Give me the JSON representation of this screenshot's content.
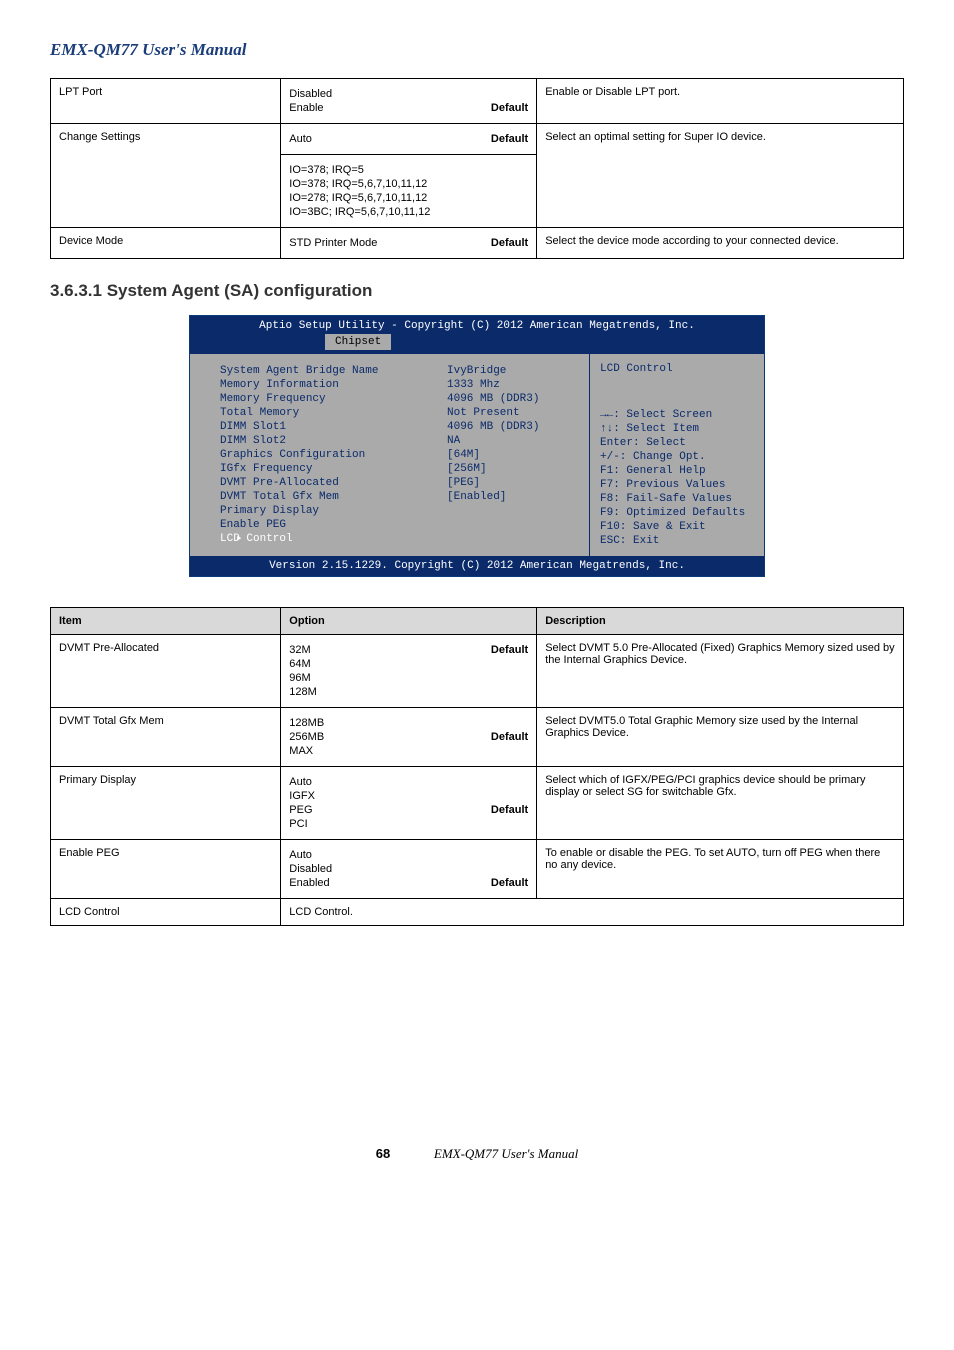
{
  "title1": "EMX-QM77 User's Manual",
  "table1": {
    "rows": [
      {
        "item": "LPT Port",
        "opts": [
          "Disabled",
          "Enable"
        ],
        "opts_note": "Default",
        "desc": "Enable or Disable LPT port."
      },
      {
        "item": "Change Settings",
        "opts": [
          "Auto"
        ],
        "opts_note": "Default",
        "row_span_first": true
      },
      {
        "item": "",
        "opts": [
          "IO=378; IRQ=5",
          "IO=378; IRQ=5,6,7,10,11,12",
          "IO=278; IRQ=5,6,7,10,11,12",
          "IO=3BC; IRQ=5,6,7,10,11,12"
        ],
        "opts_note": "",
        "desc_span": "Select an optimal setting for Super IO device."
      },
      {
        "item": "Device Mode",
        "opts": [
          "STD Printer Mode"
        ],
        "opts_note": "Default",
        "desc": "Select the device mode according to your connected device."
      }
    ]
  },
  "section_head": "3.6.3.1 System Agent (SA) configuration",
  "bios": {
    "top": "Aptio Setup Utility - Copyright (C) 2012 American Megatrends, Inc.",
    "tab": "Chipset",
    "help_title": "LCD Control",
    "left": [
      {
        "l": "System Agent Bridge Name",
        "m": "IvyBridge"
      },
      {
        "l": " ",
        "m": " "
      },
      {
        "l": "Memory Information",
        "m": " "
      },
      {
        "l": " ",
        "m": " "
      },
      {
        "l": "Memory Frequency",
        "m": "1333 Mhz"
      },
      {
        "l": "Total Memory",
        "m": "4096 MB (DDR3)"
      },
      {
        "l": "DIMM Slot1",
        "m": "Not Present"
      },
      {
        "l": "DIMM Slot2",
        "m": "4096 MB (DDR3)"
      },
      {
        "l": " ",
        "m": " "
      },
      {
        "l": "Graphics Configuration",
        "m": " "
      },
      {
        "l": " ",
        "m": " "
      },
      {
        "l": "IGfx Frequency",
        "m": "NA"
      },
      {
        "l": "DVMT Pre-Allocated",
        "m": "[64M]"
      },
      {
        "l": "DVMT Total Gfx Mem",
        "m": "[256M]"
      },
      {
        "l": "Primary Display",
        "m": "[PEG]"
      },
      {
        "l": "Enable PEG",
        "m": "[Enabled]"
      },
      {
        "l": " ",
        "m": " "
      },
      {
        "l": "LCD Control",
        "m": " ",
        "sel": true,
        "tri": "▸"
      }
    ],
    "hints": [
      "→←: Select Screen",
      "↑↓: Select Item",
      "Enter: Select",
      "+/-: Change Opt.",
      "F1: General Help",
      "F7: Previous Values",
      "F8: Fail-Safe Values",
      "F9: Optimized Defaults",
      "F10: Save & Exit",
      "ESC: Exit"
    ],
    "footer": "Version 2.15.1229. Copyright (C) 2012 American Megatrends, Inc."
  },
  "table2": {
    "headers": [
      "Item",
      "Option",
      "Description"
    ],
    "rows": [
      {
        "item": "DVMT Pre-Allocated",
        "opts_first_note": "Default",
        "opts": [
          "32M",
          "64M",
          "96M",
          "128M"
        ],
        "desc": "Select DVMT 5.0 Pre-Allocated (Fixed) Graphics Memory sized used by the Internal Graphics Device."
      },
      {
        "item": "DVMT Total Gfx Mem",
        "opts": [
          "128MB",
          "256MB",
          "MAX"
        ],
        "opts_note_idx": 1,
        "opts_note": "Default",
        "desc": "Select DVMT5.0 Total Graphic Memory size used by the Internal Graphics Device."
      },
      {
        "item": "Primary Display",
        "opts": [
          "Auto",
          "IGFX",
          "PEG",
          "PCI"
        ],
        "opts_note_idx": 2,
        "opts_note": "Default",
        "desc": "Select which of IGFX/PEG/PCI graphics device should be primary display or select SG for switchable Gfx."
      },
      {
        "item": "Enable PEG",
        "opts": [
          "Auto",
          "Disabled",
          "Enabled"
        ],
        "opts_note_idx": 2,
        "opts_note": "Default",
        "desc": "To enable or disable the PEG. To set AUTO, turn off PEG when there no any device."
      },
      {
        "item": "LCD Control",
        "opts_colspan": true,
        "desc": "LCD Control."
      }
    ]
  },
  "pagefoot": {
    "pn": "68",
    "um": "EMX-QM77 User's Manual"
  },
  "chart_data": {
    "type": "table",
    "title": "BIOS Chipset — System Agent (SA) configuration",
    "rows": [
      [
        "System Agent Bridge Name",
        "IvyBridge"
      ],
      [
        "Memory Frequency",
        "1333 Mhz"
      ],
      [
        "Total Memory",
        "4096 MB (DDR3)"
      ],
      [
        "DIMM Slot1",
        "Not Present"
      ],
      [
        "DIMM Slot2",
        "4096 MB (DDR3)"
      ],
      [
        "IGfx Frequency",
        "NA"
      ],
      [
        "DVMT Pre-Allocated",
        "[64M]"
      ],
      [
        "DVMT Total Gfx Mem",
        "[256M]"
      ],
      [
        "Primary Display",
        "[PEG]"
      ],
      [
        "Enable PEG",
        "[Enabled]"
      ]
    ]
  }
}
